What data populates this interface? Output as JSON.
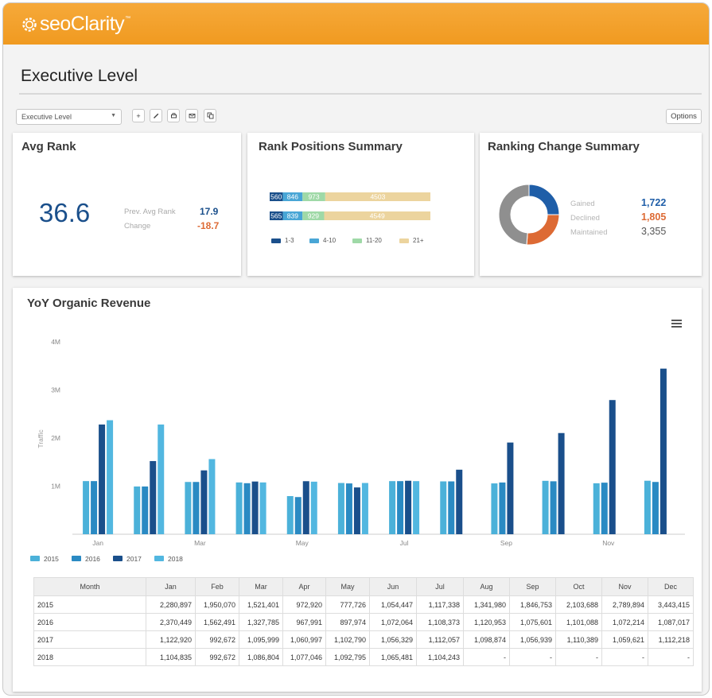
{
  "header": {
    "logo": "seoClarity",
    "tm": "™"
  },
  "page_title": "Executive Level",
  "toolbar": {
    "dropdown_value": "Executive Level",
    "options_label": "Options",
    "buttons": [
      "plus-icon",
      "pencil-icon",
      "print-icon",
      "email-icon",
      "copy-icon"
    ]
  },
  "avg_rank": {
    "title": "Avg Rank",
    "value": "36.6",
    "prev_label": "Prev. Avg Rank",
    "prev_value": "17.9",
    "change_label": "Change",
    "change_value": "-18.7"
  },
  "rank_positions": {
    "title": "Rank Positions Summary",
    "rows": [
      {
        "segments": [
          560,
          846,
          973,
          4503
        ],
        "labels": [
          "560",
          "846",
          "973",
          "4503"
        ]
      },
      {
        "segments": [
          565,
          839,
          929,
          4549
        ],
        "labels": [
          "565",
          "839",
          "929",
          "4549"
        ]
      }
    ],
    "legend": [
      "1-3",
      "4-10",
      "11-20",
      "21+"
    ],
    "colors": [
      "#1a4f8b",
      "#49a6d6",
      "#9fd9a7",
      "#ecd49e"
    ]
  },
  "ranking_change": {
    "title": "Ranking Change Summary",
    "items": [
      {
        "label": "Gained",
        "value": "1,722",
        "num": 1722,
        "color": "#1f5ea8"
      },
      {
        "label": "Declined",
        "value": "1,805",
        "num": 1805,
        "color": "#dd6a34"
      },
      {
        "label": "Maintained",
        "value": "3,355",
        "num": 3355,
        "color": "#8f8f8f"
      }
    ]
  },
  "yoy": {
    "title": "YoY Organic Revenue",
    "ylabel": "Traffic",
    "table_header": [
      "Month",
      "Jan",
      "Feb",
      "Mar",
      "Apr",
      "May",
      "Jun",
      "Jul",
      "Aug",
      "Sep",
      "Oct",
      "Nov",
      "Dec"
    ],
    "table_rows": [
      [
        "2015",
        "2,280,897",
        "1,950,070",
        "1,521,401",
        "972,920",
        "777,726",
        "1,054,447",
        "1,117,338",
        "1,341,980",
        "1,846,753",
        "2,103,688",
        "2,789,894",
        "3,443,415"
      ],
      [
        "2016",
        "2,370,449",
        "1,562,491",
        "1,327,785",
        "967,991",
        "897,974",
        "1,072,064",
        "1,108,373",
        "1,120,953",
        "1,075,601",
        "1,101,088",
        "1,072,214",
        "1,087,017"
      ],
      [
        "2017",
        "1,122,920",
        "992,672",
        "1,095,999",
        "1,060,997",
        "1,102,790",
        "1,056,329",
        "1,112,057",
        "1,098,874",
        "1,056,939",
        "1,110,389",
        "1,059,621",
        "1,112,218"
      ],
      [
        "2018",
        "1,104,835",
        "992,672",
        "1,086,804",
        "1,077,046",
        "1,092,795",
        "1,065,481",
        "1,104,243",
        "-",
        "-",
        "-",
        "-",
        "-"
      ]
    ]
  },
  "chart_data": {
    "type": "bar",
    "title": "YoY Organic Revenue",
    "xlabel": "",
    "ylabel": "Traffic",
    "ylim": [
      0,
      4000000
    ],
    "yticks": [
      "1M",
      "2M",
      "3M",
      "4M"
    ],
    "categories": [
      "Jan",
      "Feb",
      "Mar",
      "Apr",
      "May",
      "Jun",
      "Jul",
      "Aug",
      "Sep",
      "Oct",
      "Nov",
      "Dec"
    ],
    "xtick_labels": [
      "Jan",
      "",
      "Mar",
      "",
      "May",
      "",
      "Jul",
      "",
      "Sep",
      "",
      "Nov",
      ""
    ],
    "grid": false,
    "legend_position": "bottom-left",
    "series": [
      {
        "name": "2015",
        "color": "#4bb1d9",
        "values": [
          1104835,
          992672,
          1086804,
          1077046,
          792795,
          1065481,
          1104243,
          1098874,
          1056939,
          1110389,
          1059621,
          1112218
        ]
      },
      {
        "name": "2016",
        "color": "#2a8ac3",
        "values": [
          1104835,
          992672,
          1086804,
          1060997,
          772795,
          1056329,
          1104243,
          1098874,
          1075601,
          1101088,
          1072214,
          1087017
        ]
      },
      {
        "name": "2017",
        "color": "#1a4f8b",
        "values": [
          2280897,
          1521401,
          1327785,
          1095999,
          1102790,
          972920,
          1112057,
          1341980,
          1906753,
          2103688,
          2789894,
          3443415
        ]
      },
      {
        "name": "2018",
        "color": "#52b7e0",
        "values": [
          2370449,
          2280897,
          1562491,
          1077046,
          1092795,
          1065481,
          1104243,
          null,
          null,
          null,
          null,
          null
        ]
      }
    ]
  }
}
